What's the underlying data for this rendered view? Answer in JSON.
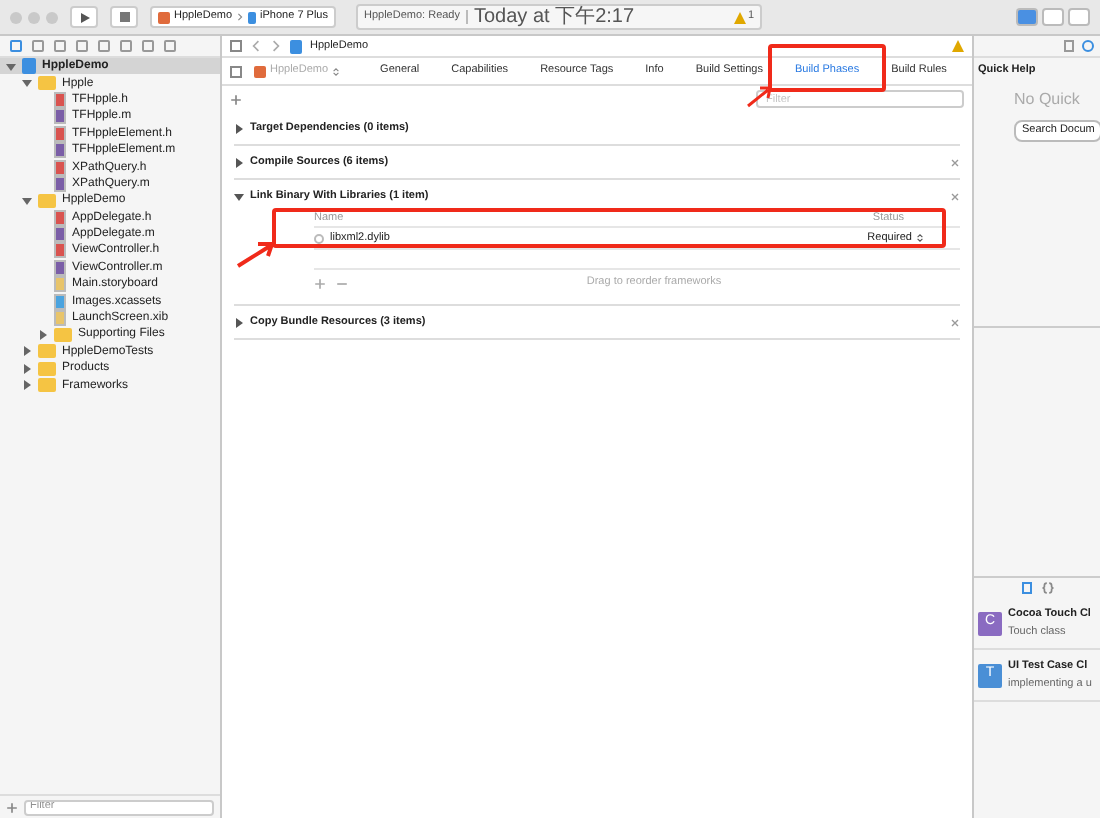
{
  "toolbar": {
    "scheme": "HppleDemo",
    "device": "iPhone 7 Plus",
    "status": "HppleDemo: Ready",
    "time": "Today at 下午2:17",
    "warnings": "1"
  },
  "navigator": {
    "tree": [
      {
        "name": "HppleDemo",
        "kind": "project",
        "expanded": true,
        "selected": true,
        "children": [
          {
            "name": "Hpple",
            "kind": "folder",
            "expanded": true,
            "selected": false,
            "children": [
              {
                "name": "TFHpple.h",
                "kind": "h",
                "selected": false
              },
              {
                "name": "TFHpple.m",
                "kind": "m",
                "selected": false
              },
              {
                "name": "TFHppleElement.h",
                "kind": "h",
                "selected": false
              },
              {
                "name": "TFHppleElement.m",
                "kind": "m",
                "selected": false
              },
              {
                "name": "XPathQuery.h",
                "kind": "h",
                "selected": false
              },
              {
                "name": "XPathQuery.m",
                "kind": "m",
                "selected": false
              }
            ]
          },
          {
            "name": "HppleDemo",
            "kind": "folder",
            "expanded": true,
            "selected": false,
            "children": [
              {
                "name": "AppDelegate.h",
                "kind": "h",
                "selected": false
              },
              {
                "name": "AppDelegate.m",
                "kind": "m",
                "selected": false
              },
              {
                "name": "ViewController.h",
                "kind": "h",
                "selected": false
              },
              {
                "name": "ViewController.m",
                "kind": "m",
                "selected": false
              },
              {
                "name": "Main.storyboard",
                "kind": "doc",
                "selected": false
              },
              {
                "name": "Images.xcassets",
                "kind": "assets",
                "selected": false
              },
              {
                "name": "LaunchScreen.xib",
                "kind": "doc",
                "selected": false
              },
              {
                "name": "Supporting Files",
                "kind": "folder",
                "expanded": false,
                "selected": false
              }
            ]
          },
          {
            "name": "HppleDemoTests",
            "kind": "folder",
            "expanded": false,
            "selected": false
          },
          {
            "name": "Products",
            "kind": "folder",
            "expanded": false,
            "selected": false
          },
          {
            "name": "Frameworks",
            "kind": "folder",
            "expanded": false,
            "selected": false
          }
        ]
      }
    ],
    "filter_placeholder": "Filter"
  },
  "editor": {
    "breadcrumb": "HppleDemo",
    "target": "HppleDemo",
    "tabs": [
      {
        "label": "General",
        "selected": false
      },
      {
        "label": "Capabilities",
        "selected": false
      },
      {
        "label": "Resource Tags",
        "selected": false
      },
      {
        "label": "Info",
        "selected": false
      },
      {
        "label": "Build Settings",
        "selected": false
      },
      {
        "label": "Build Phases",
        "selected": true
      },
      {
        "label": "Build Rules",
        "selected": false
      }
    ],
    "filter_placeholder": "Filter",
    "phases": [
      {
        "title": "Target Dependencies (0 items)",
        "expanded": false,
        "removable": false
      },
      {
        "title": "Compile Sources (6 items)",
        "expanded": false,
        "removable": true
      },
      {
        "title": "Link Binary With Libraries (1 item)",
        "expanded": true,
        "removable": true,
        "columns": [
          "Name",
          "Status"
        ],
        "rows": [
          {
            "name": "libxml2.dylib",
            "status": "Required"
          }
        ],
        "hint": "Drag to reorder frameworks"
      },
      {
        "title": "Copy Bundle Resources (3 items)",
        "expanded": false,
        "removable": true
      }
    ]
  },
  "inspector": {
    "title": "Quick Help",
    "message": "No Quick",
    "button": "Search Docum",
    "library": [
      {
        "letter": "C",
        "title": "Cocoa Touch Cl",
        "subtitle": "Touch class"
      },
      {
        "letter": "T",
        "title": "UI Test Case Cl",
        "subtitle": "implementing a u"
      }
    ]
  }
}
